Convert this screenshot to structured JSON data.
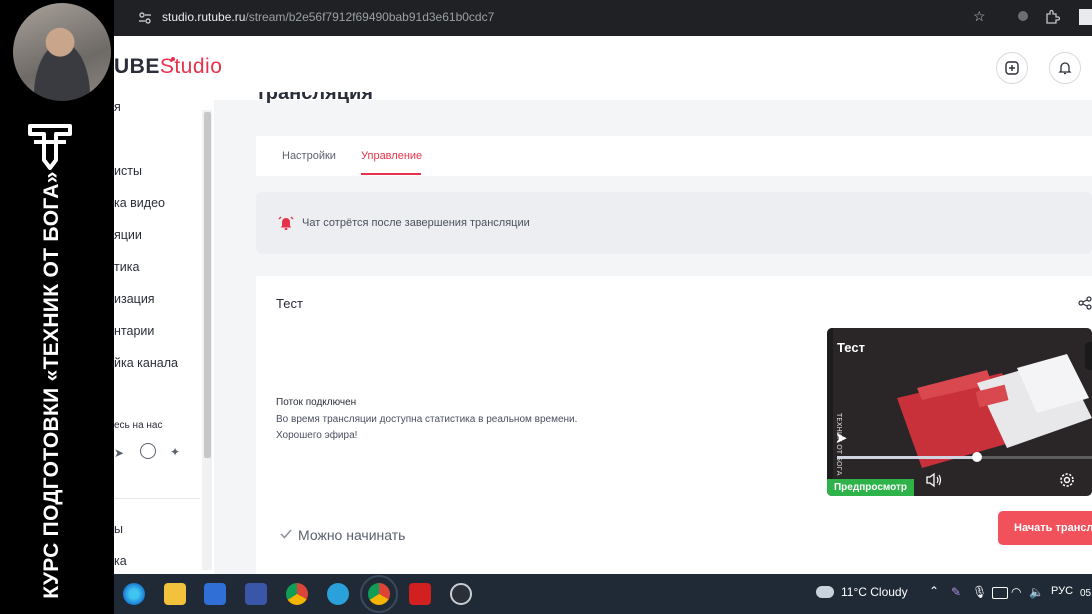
{
  "overlay": {
    "course_title": "КУРС ПОДГОТОВКИ «ТЕХНИК ОТ БОГА»"
  },
  "browser": {
    "url_host": "studio.rutube.ru",
    "url_path": "/stream/b2e56f7912f69490bab91d3e61b0cdc7"
  },
  "header": {
    "brand_main": "UBE",
    "brand_studio": "Studio"
  },
  "sidebar": {
    "items": [
      "я",
      "исты",
      "ка видео",
      "яции",
      "тика",
      "изация",
      "нтарии",
      "йка канала",
      "есь на нас",
      "ы",
      "ка"
    ]
  },
  "page_heading_fragment": "трансляция",
  "tabs": [
    "Настройки",
    "Управление"
  ],
  "notice": "Чат сотрётся после завершения трансляции",
  "stream": {
    "title": "Тест",
    "status_heading": "Поток подключен",
    "status_line1": "Во время трансляции доступна статистика в реальном времени.",
    "status_line2": "Хорошего эфира!",
    "ready_label": "Можно начинать",
    "start_button": "Начать трансля"
  },
  "preview": {
    "title": "Тест",
    "badge": "Предпросмотр",
    "progress": 0.55
  },
  "taskbar": {
    "weather": "11°C  Cloudy",
    "language": "РУС",
    "clock_fragment": "05"
  },
  "colors": {
    "accent": "#e5334b",
    "start_button": "#f0515b",
    "preview_badge": "#2db34a"
  }
}
